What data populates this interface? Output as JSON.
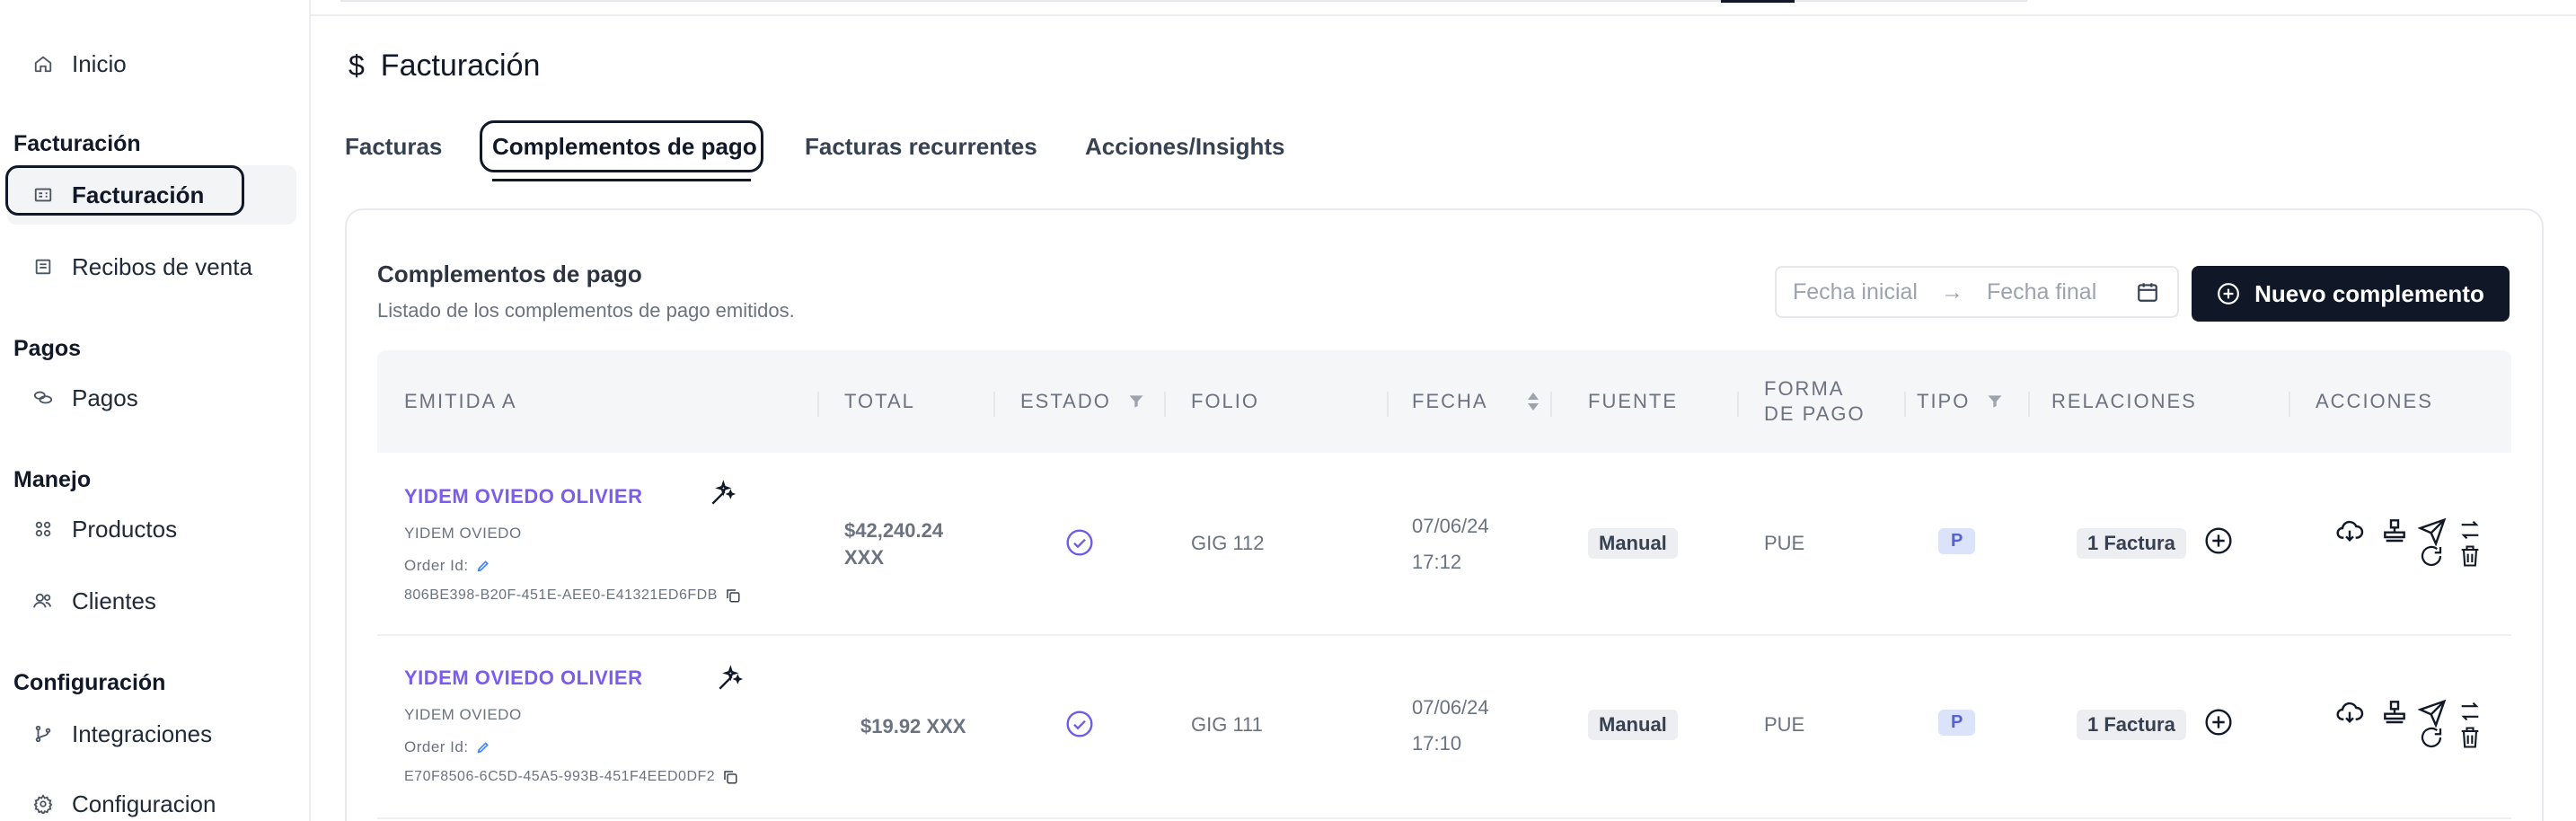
{
  "sidebar": {
    "inicio": "Inicio",
    "sections": {
      "facturacion": "Facturación",
      "pagos": "Pagos",
      "manejo": "Manejo",
      "configuracion": "Configuración"
    },
    "items": {
      "facturacion": "Facturación",
      "recibos": "Recibos de venta",
      "pagos": "Pagos",
      "productos": "Productos",
      "clientes": "Clientes",
      "integraciones": "Integraciones",
      "configuracion": "Configuracion"
    }
  },
  "page": {
    "title": "Facturación",
    "icon": "dollar-icon"
  },
  "tabs": {
    "facturas": "Facturas",
    "complementos": "Complementos de pago",
    "recurrentes": "Facturas recurrentes",
    "acciones": "Acciones/Insights"
  },
  "card": {
    "title": "Complementos de pago",
    "subtitle": "Listado de los complementos de pago emitidos.",
    "date_start_placeholder": "Fecha inicial",
    "date_end_placeholder": "Fecha final",
    "new_button": "Nuevo complemento"
  },
  "table": {
    "headers": {
      "emitida": "EMITIDA A",
      "total": "TOTAL",
      "estado": "ESTADO",
      "folio": "FOLIO",
      "fecha": "FECHA",
      "fuente": "FUENTE",
      "forma_1": "FORMA",
      "forma_2": "DE PAGO",
      "tipo": "TIPO",
      "relaciones": "RELACIONES",
      "acciones": "ACCIONES"
    },
    "rows": [
      {
        "name": "YIDEM OVIEDO OLIVIER",
        "sub": "YIDEM OVIEDO",
        "order_label": "Order Id:",
        "uuid": "806BE398-B20F-451E-AEE0-E41321ED6FDB",
        "total_1": "$42,240.24",
        "total_2": "XXX",
        "folio": "GIG 112",
        "date": "07/06/24",
        "time": "17:12",
        "fuente": "Manual",
        "forma": "PUE",
        "tipo": "P",
        "relaciones": "1 Factura"
      },
      {
        "name": "YIDEM OVIEDO OLIVIER",
        "sub": "YIDEM OVIEDO",
        "order_label": "Order Id:",
        "uuid": "E70F8506-6C5D-45A5-993B-451F4EED0DF2",
        "total_1": "$19.92 XXX",
        "total_2": "",
        "folio": "GIG 111",
        "date": "07/06/24",
        "time": "17:10",
        "fuente": "Manual",
        "forma": "PUE",
        "tipo": "P",
        "relaciones": "1 Factura"
      }
    ]
  },
  "colors": {
    "accent_dark": "#101828",
    "link_purple": "#7c5cf0",
    "tipo_badge_bg": "#dbe3fb",
    "tipo_badge_fg": "#5561d6"
  }
}
